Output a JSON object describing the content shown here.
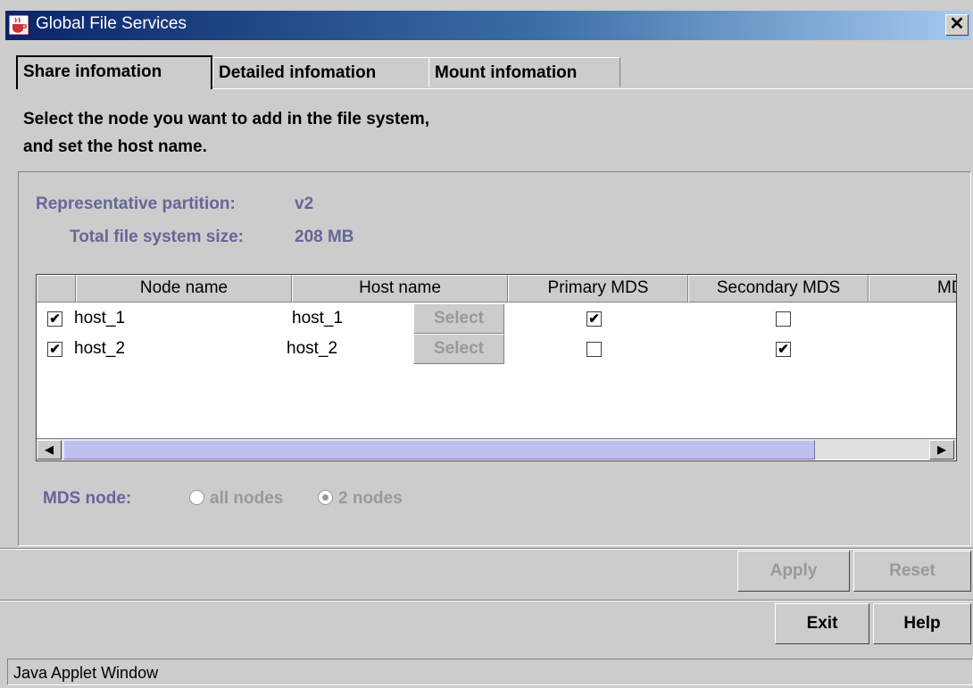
{
  "window": {
    "title": "Global File Services",
    "close_glyph": "✕",
    "icon": "java-cup-icon"
  },
  "tabs": [
    {
      "label": "Share infomation",
      "active": true
    },
    {
      "label": "Detailed infomation",
      "active": false
    },
    {
      "label": "Mount infomation",
      "active": false
    }
  ],
  "instructions": {
    "line1": "Select the node you want to add in the file system,",
    "line2": "and set the host name."
  },
  "info": {
    "partition_label": "Representative partition:",
    "partition_value": "v2",
    "size_label": "Total file system size:",
    "size_value": "208 MB"
  },
  "table": {
    "columns": [
      "",
      "Node name",
      "Host name",
      "Primary MDS",
      "Secondary MDS",
      "MD"
    ],
    "rows": [
      {
        "checked": "✔",
        "node": "host_1",
        "host": "host_1",
        "button": "Select",
        "primary": "✔",
        "secondary": ""
      },
      {
        "checked": "✔",
        "node": "host_2",
        "host": "host_2",
        "button": "Select",
        "primary": "",
        "secondary": "✔"
      }
    ]
  },
  "scrollbar": {
    "left_arrow": "◀",
    "right_arrow": "▶"
  },
  "mds": {
    "label": "MDS node:",
    "options": [
      {
        "label": "all nodes",
        "selected": false
      },
      {
        "label": "2 nodes",
        "selected": true
      }
    ]
  },
  "buttons": {
    "apply": "Apply",
    "reset": "Reset",
    "exit": "Exit",
    "help": "Help"
  },
  "status": "Java Applet Window"
}
